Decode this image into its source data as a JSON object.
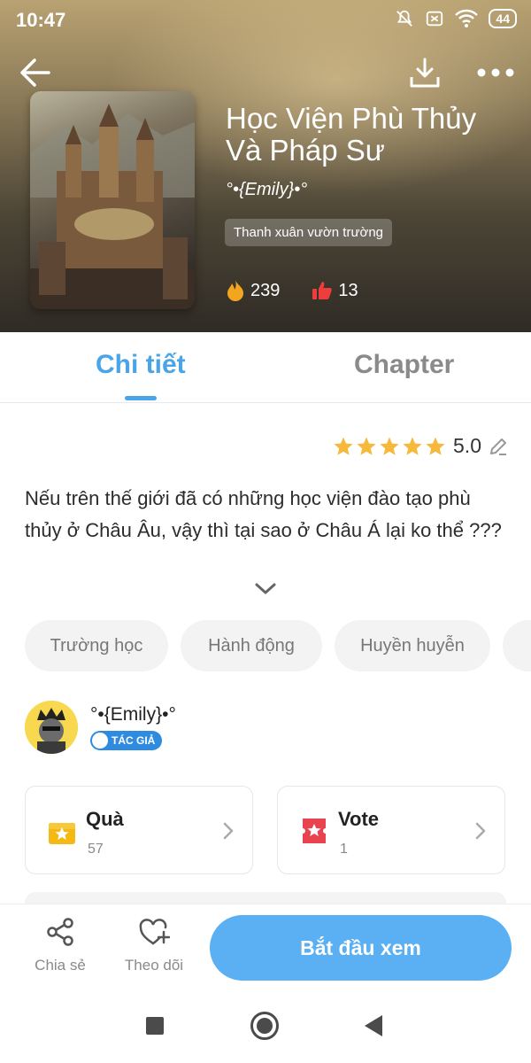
{
  "status_bar": {
    "time": "10:47",
    "battery": "44"
  },
  "header": {
    "back_icon": "arrow-left-icon",
    "download_icon": "download-icon",
    "more_icon": "more-icon"
  },
  "book": {
    "title": "Học Viện Phù Thủy Và Pháp Sư",
    "author": "°•{Emily}•°",
    "genre": "Thanh xuân vườn trường",
    "views": "239",
    "likes": "13"
  },
  "tabs": [
    {
      "label": "Chi tiết",
      "active": true
    },
    {
      "label": "Chapter",
      "active": false
    }
  ],
  "rating": {
    "value": "5.0",
    "stars": 5
  },
  "description": "Nếu trên thế giới đã có những học viện đào tạo phù thủy ở Châu Âu, vậy thì tại sao ở Châu Á lại ko thể ???",
  "tags": [
    "Trường học",
    "Hành động",
    "Huyền huyễn"
  ],
  "author_info": {
    "name": "°•{Emily}•°",
    "badge": "TÁC GIẢ"
  },
  "cards": {
    "gift": {
      "title": "Quà",
      "count": "57"
    },
    "vote": {
      "title": "Vote",
      "count": "1"
    }
  },
  "bottom_bar": {
    "share_label": "Chia sẻ",
    "follow_label": "Theo dõi",
    "start_label": "Bắt đầu xem"
  },
  "colors": {
    "accent": "#4aa5e8",
    "button": "#5ab0f2",
    "star": "#f6b93b",
    "like": "#ef3d3d",
    "fire": "#f3a51f"
  }
}
